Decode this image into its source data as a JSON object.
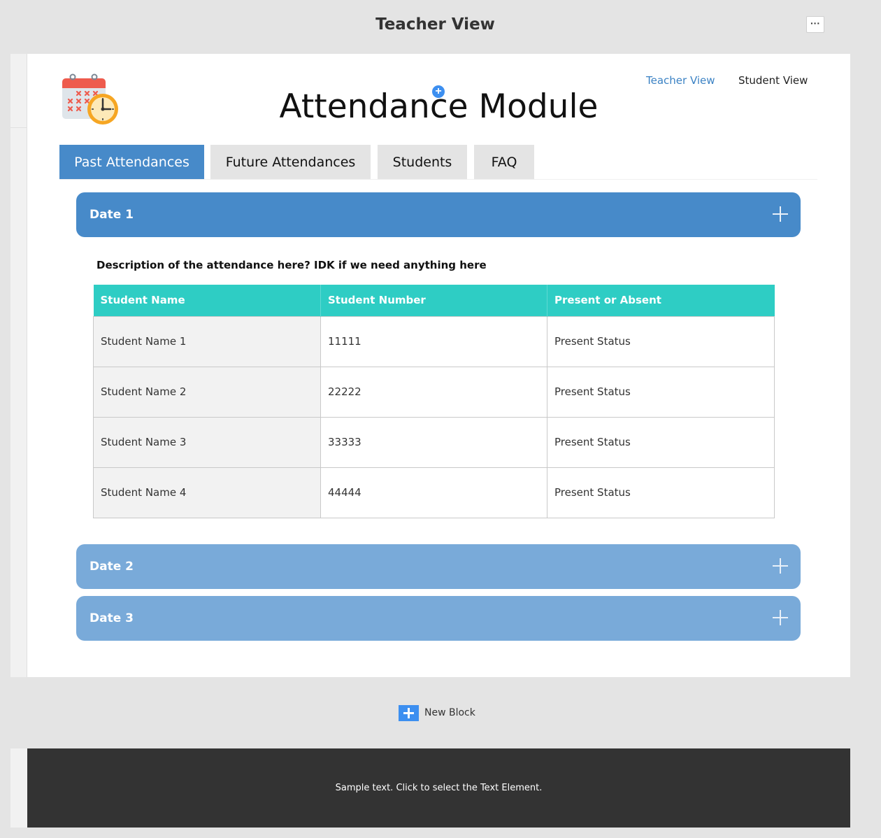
{
  "window": {
    "title": "Teacher View",
    "more_icon": "ellipsis-icon",
    "more_label": "···"
  },
  "header": {
    "logo_icon": "calendar-clock-icon",
    "title": "Attendance Module",
    "views": [
      {
        "label": "Teacher View",
        "color": "#3b82c4"
      },
      {
        "label": "Student View",
        "color": "#222222"
      }
    ]
  },
  "tabs": [
    {
      "label": "Past Attendances",
      "active": true
    },
    {
      "label": "Future Attendances",
      "active": false
    },
    {
      "label": "Students",
      "active": false
    },
    {
      "label": "FAQ",
      "active": false
    }
  ],
  "accordion": [
    {
      "label": "Date 1",
      "open": true
    },
    {
      "label": "Date 2",
      "open": false
    },
    {
      "label": "Date 3",
      "open": false
    }
  ],
  "content": {
    "description": "Description of the attendance here? IDK if we need anything here",
    "table": {
      "headers": [
        "Student Name",
        "Student Number",
        "Present or Absent"
      ],
      "rows": [
        [
          "Student Name 1",
          "11111",
          "Present Status"
        ],
        [
          "Student Name 2",
          "22222",
          "Present Status"
        ],
        [
          "Student Name 3",
          "33333",
          "Present Status"
        ],
        [
          "Student Name 4",
          "44444",
          "Present Status"
        ]
      ]
    }
  },
  "new_block": {
    "label": "New Block",
    "icon": "plus-icon"
  },
  "footer": {
    "text": "Sample text. Click to select the Text Element."
  },
  "colors": {
    "primary": "#478ac9",
    "primary_light": "#79aad9",
    "table_header": "#2ecdc4",
    "footer_bg": "#333333",
    "add_blue": "#3d8ff0"
  }
}
